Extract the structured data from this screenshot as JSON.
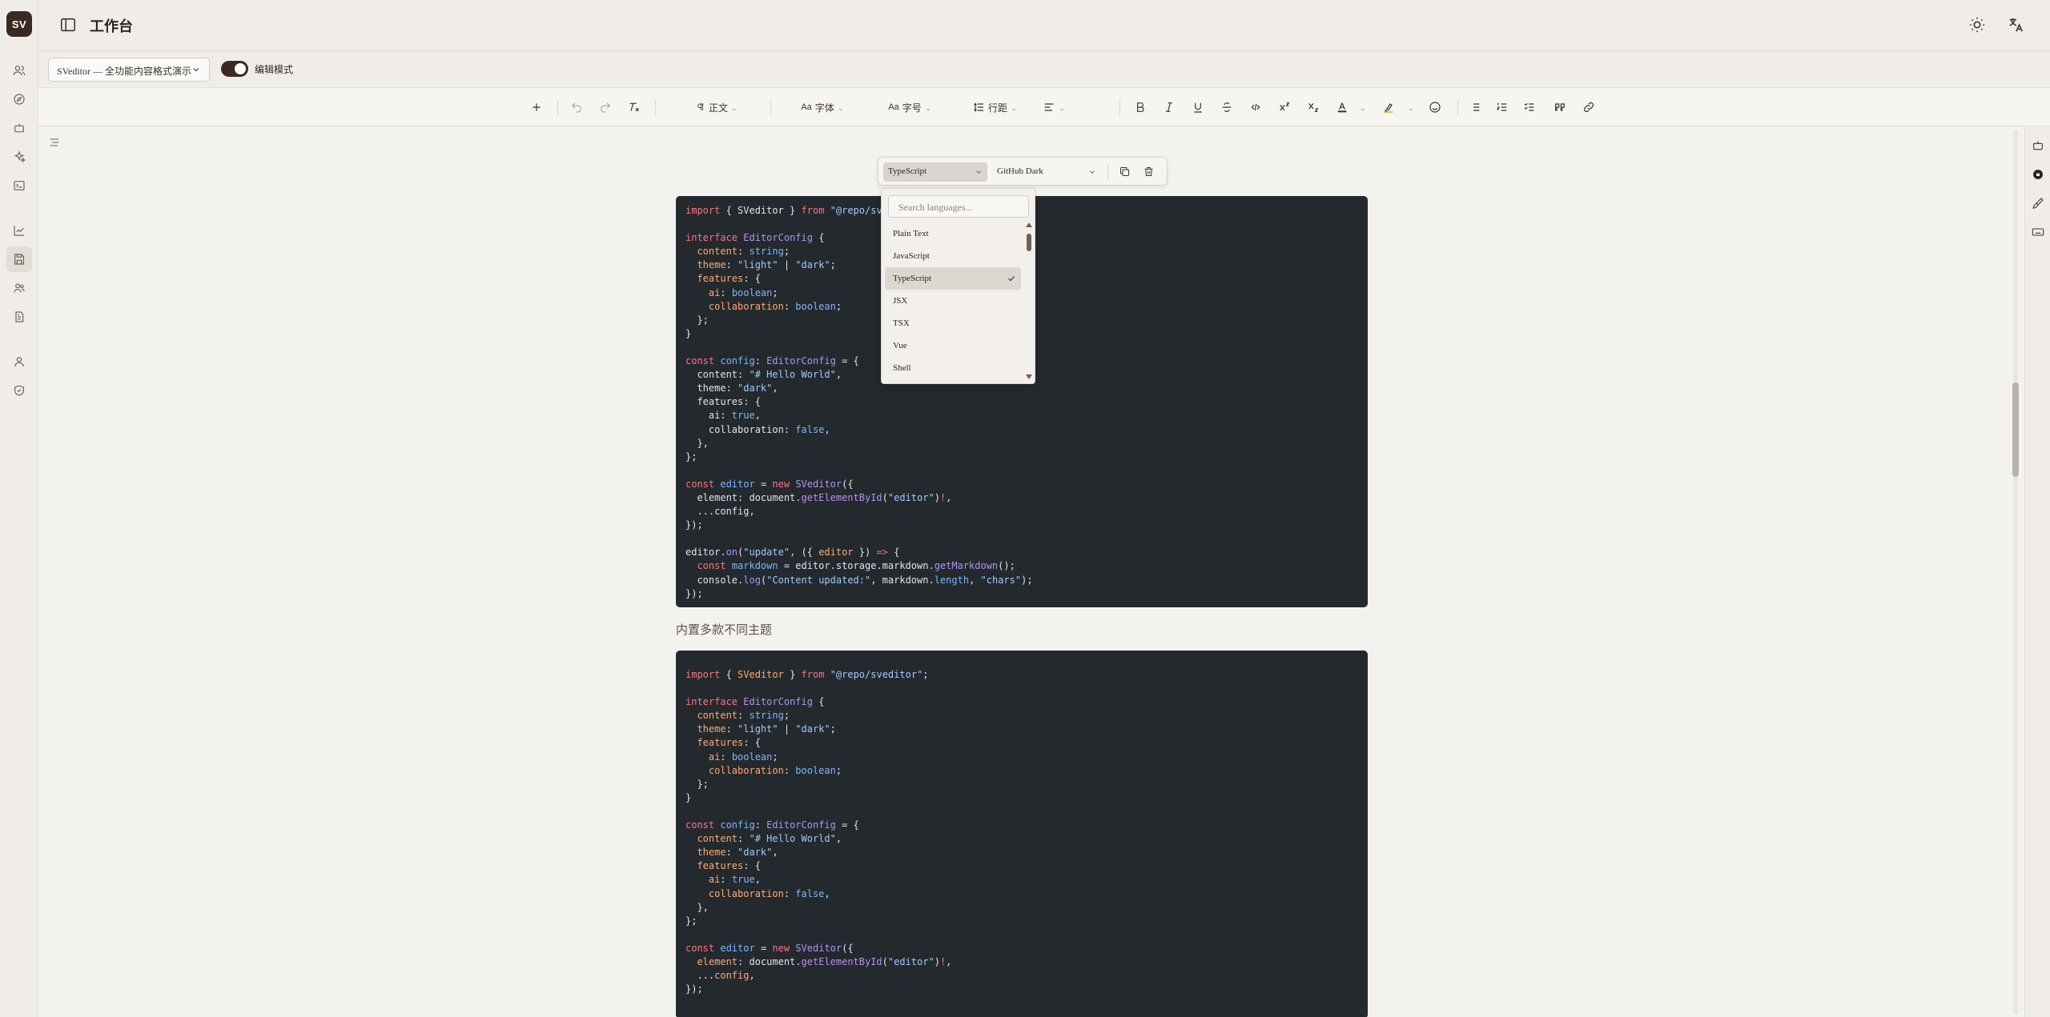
{
  "app": {
    "logo_text": "SV",
    "page_title": "工作台"
  },
  "docbar": {
    "selected_doc": "SVeditor — 全功能内容格式演示",
    "edit_mode_label": "编辑模式",
    "edit_mode_on": true
  },
  "toolbar": {
    "paragraph_label": "正文",
    "font_label": "字体",
    "font_size_label": "字号",
    "line_height_label": "行距"
  },
  "code_toolbar": {
    "language": "TypeScript",
    "theme": "GitHub Dark"
  },
  "lang_dropdown": {
    "search_placeholder": "Search languages...",
    "options": [
      "Plain Text",
      "JavaScript",
      "TypeScript",
      "JSX",
      "TSX",
      "Vue",
      "Shell"
    ],
    "selected": "TypeScript"
  },
  "content": {
    "theme_caption": "内置多款不同主题"
  },
  "colors": {
    "code_bg": "#24292e",
    "accent": "#3a2a22"
  }
}
